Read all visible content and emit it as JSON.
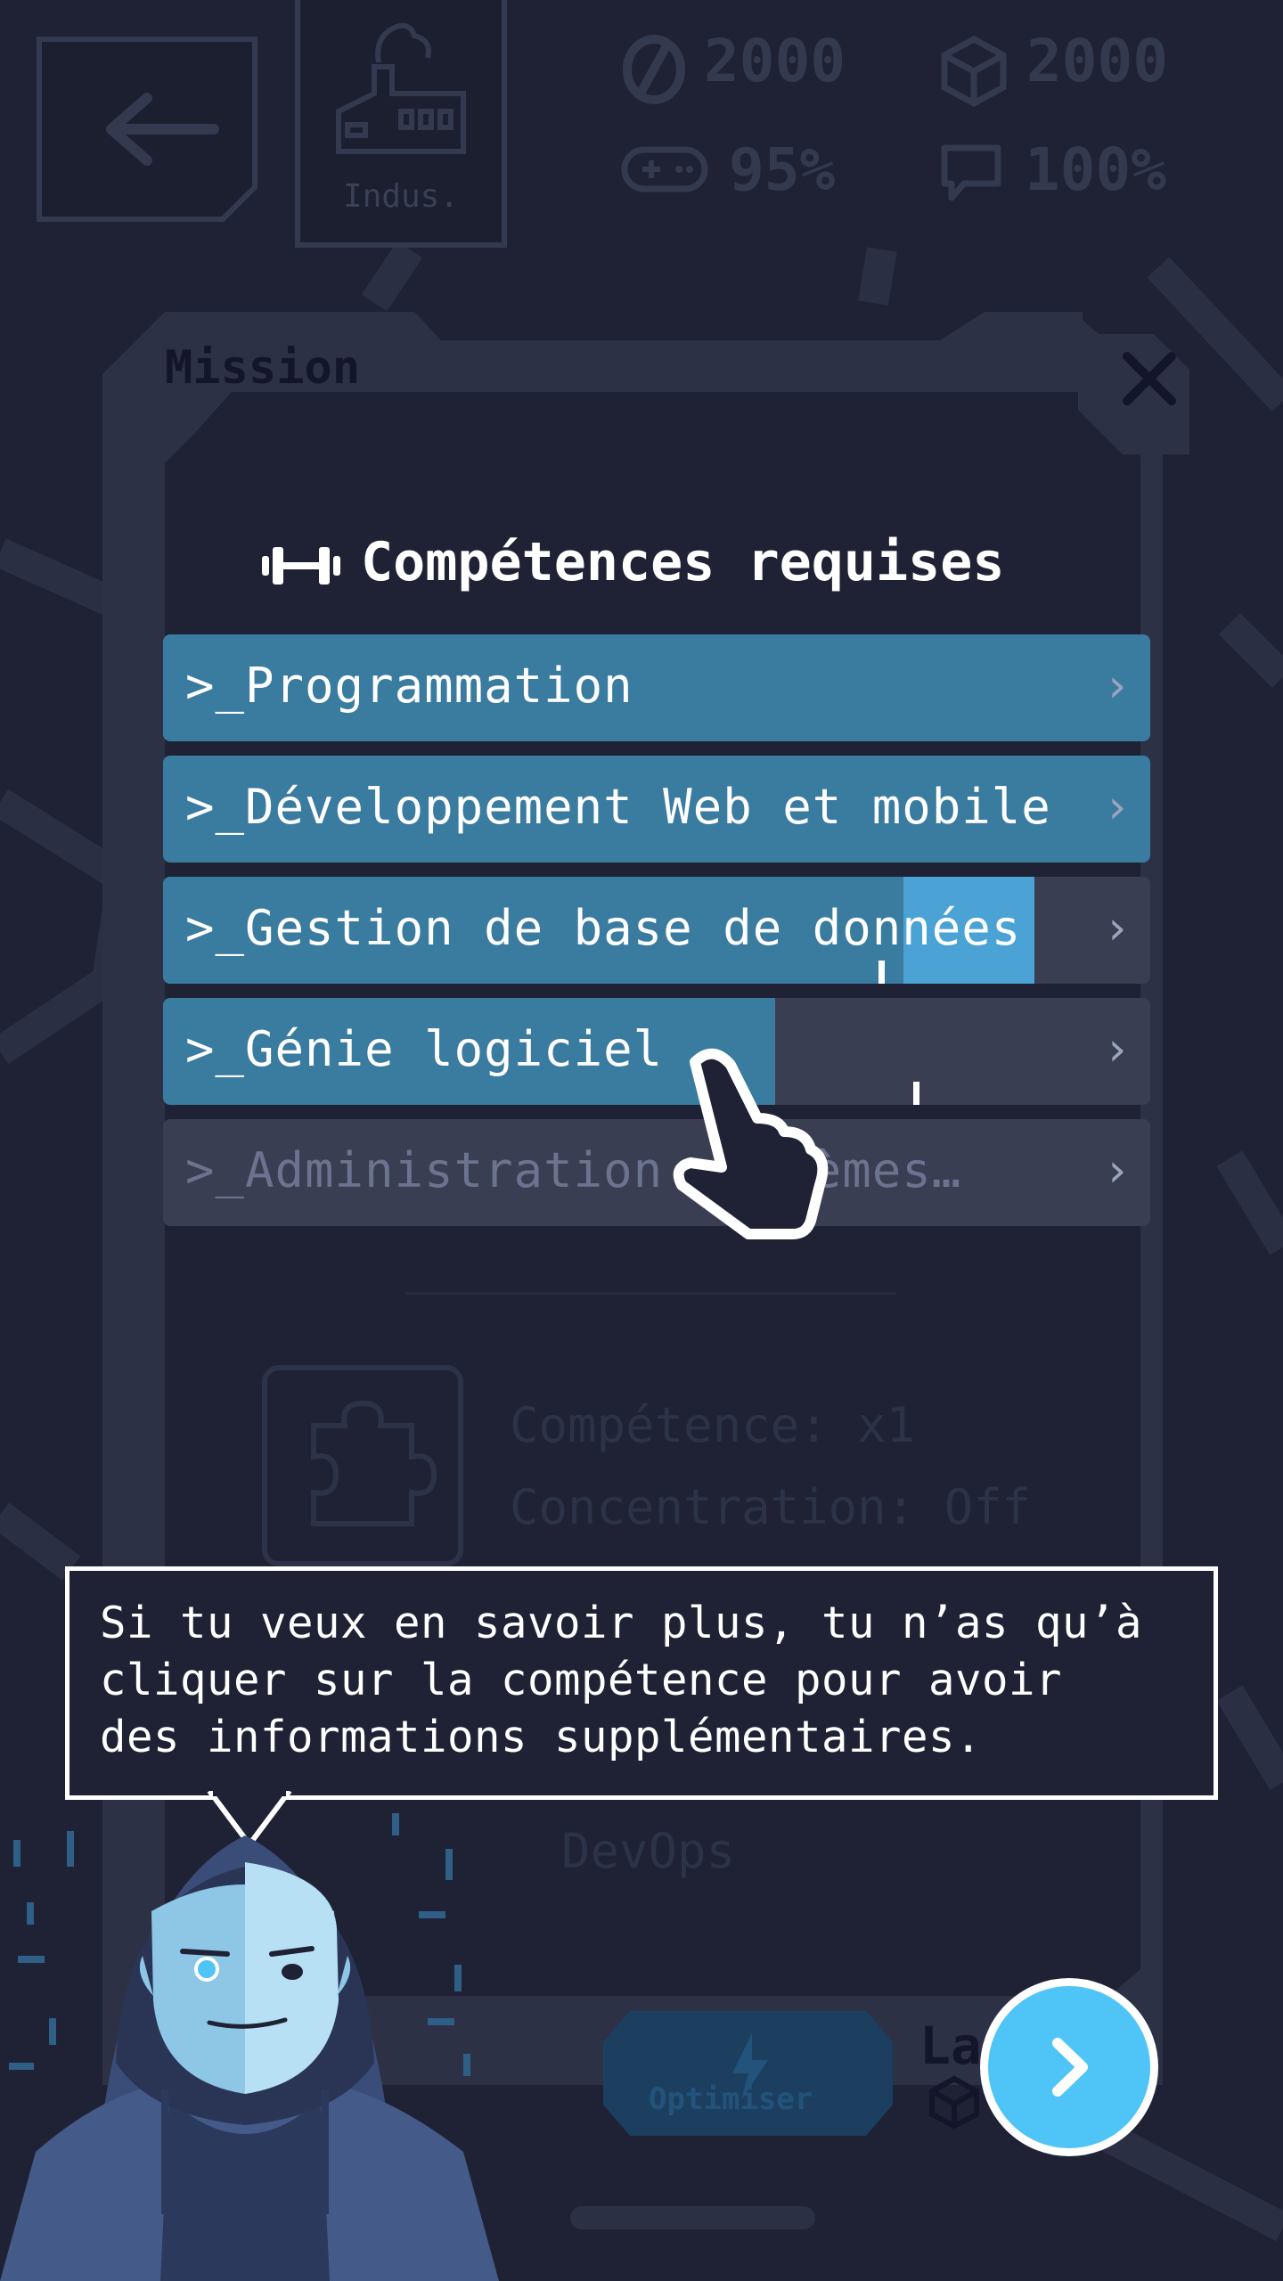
{
  "topbar": {
    "back_icon": "arrow-left-icon",
    "category_label": "Indus.",
    "stats": {
      "money": "2000",
      "resources": "2000",
      "fun": "95%",
      "communication": "100%"
    }
  },
  "modal": {
    "title": "Mission",
    "close_icon": "close-icon",
    "section_title": "Compétences requises",
    "skills": [
      {
        "label": ">_Programmation",
        "progress": 1.0
      },
      {
        "label": ">_Développement Web et mobile",
        "progress": 1.0
      },
      {
        "label": ">_Gestion de base de données",
        "progress": 0.75
      },
      {
        "label": ">_Génie logiciel",
        "progress": 0.62
      },
      {
        "label": ">_Administration systèmes…",
        "progress": 0.0
      }
    ],
    "skill_stats": {
      "competence": "Compétence: x1",
      "concentration": "Concentration: Off"
    },
    "devops_label": "DevOps",
    "optimize_label": "Optimiser",
    "launch_label": "La"
  },
  "tutorial": {
    "message": "Si tu veux en savoir plus, tu n’as qu’à\ncliquer sur la compétence pour avoir\ndes informations supplémentaires.",
    "next_icon": "chevron-right-icon"
  },
  "colors": {
    "background": "#1e2234",
    "skill_fill": "#3a7ba0",
    "skill_fill_light": "#4aa3d4",
    "next_button": "#4fc4f7"
  }
}
